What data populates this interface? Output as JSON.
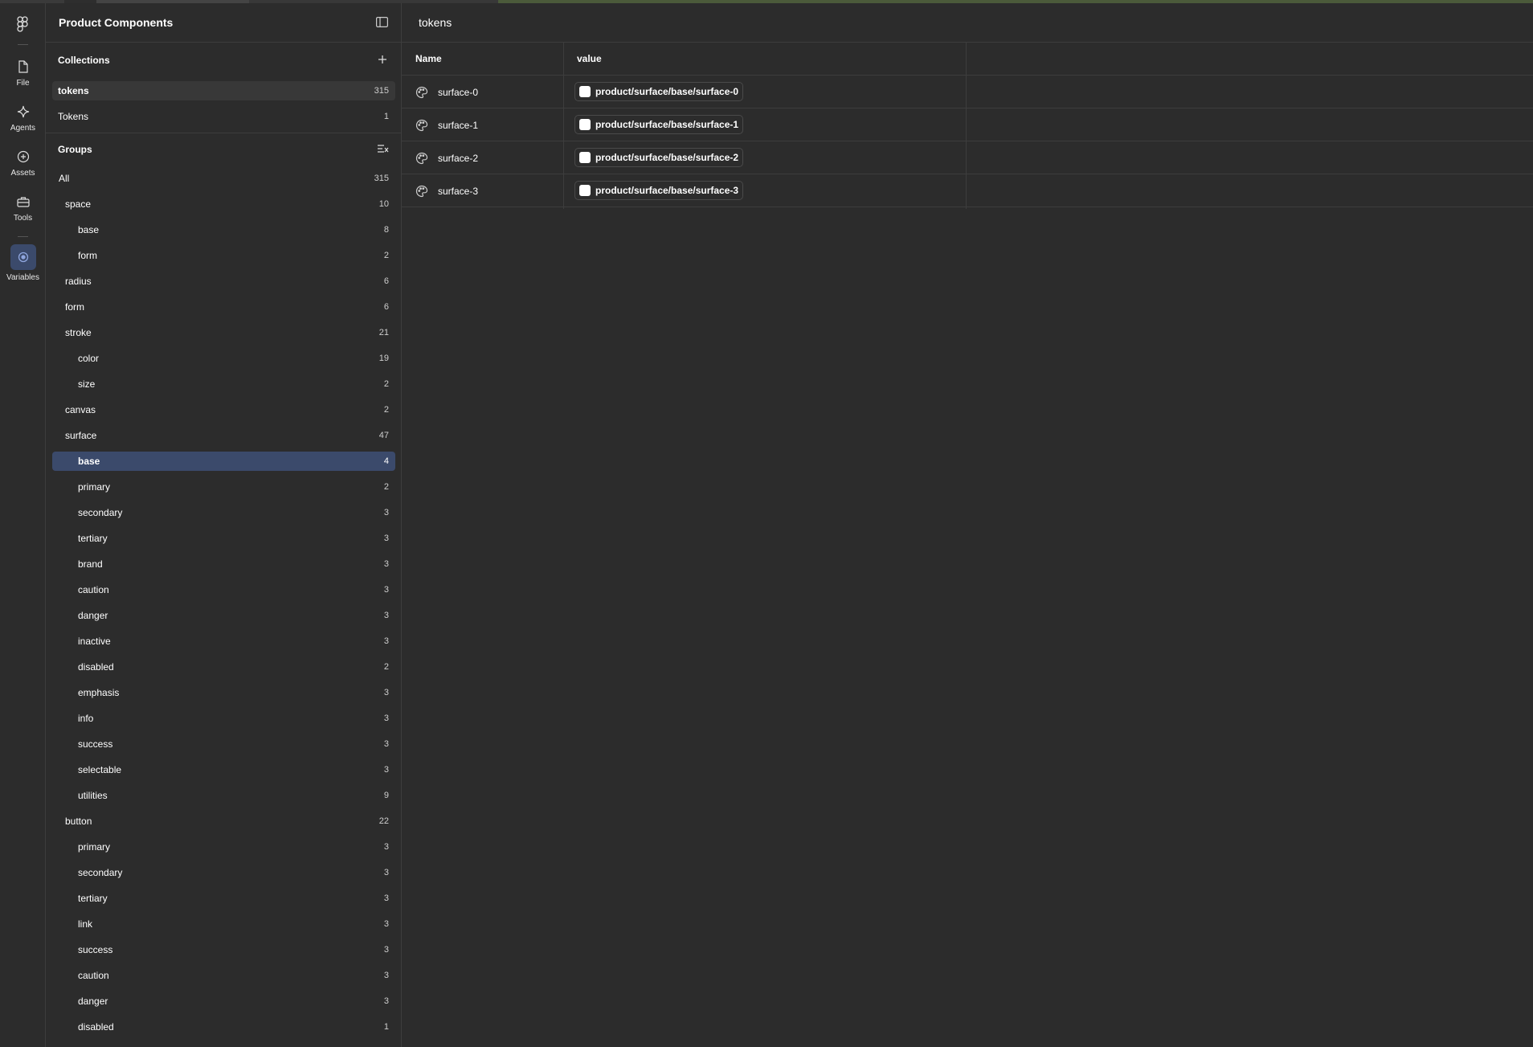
{
  "rail": {
    "items": [
      {
        "label": "File",
        "icon": "file-icon"
      },
      {
        "label": "Agents",
        "icon": "sparkle-icon"
      },
      {
        "label": "Assets",
        "icon": "assets-icon"
      },
      {
        "label": "Tools",
        "icon": "toolbox-icon"
      },
      {
        "label": "Variables",
        "icon": "variables-icon"
      }
    ]
  },
  "sidebar": {
    "title": "Product Components",
    "collections": {
      "title": "Collections",
      "items": [
        {
          "name": "tokens",
          "count": "315"
        },
        {
          "name": "Tokens",
          "count": "1"
        }
      ]
    },
    "groups": {
      "title": "Groups",
      "items": [
        {
          "name": "All",
          "count": "315"
        },
        {
          "name": "space",
          "count": "10"
        },
        {
          "name": "base",
          "count": "8"
        },
        {
          "name": "form",
          "count": "2"
        },
        {
          "name": "radius",
          "count": "6"
        },
        {
          "name": "form",
          "count": "6"
        },
        {
          "name": "stroke",
          "count": "21"
        },
        {
          "name": "color",
          "count": "19"
        },
        {
          "name": "size",
          "count": "2"
        },
        {
          "name": "canvas",
          "count": "2"
        },
        {
          "name": "surface",
          "count": "47"
        },
        {
          "name": "base",
          "count": "4"
        },
        {
          "name": "primary",
          "count": "2"
        },
        {
          "name": "secondary",
          "count": "3"
        },
        {
          "name": "tertiary",
          "count": "3"
        },
        {
          "name": "brand",
          "count": "3"
        },
        {
          "name": "caution",
          "count": "3"
        },
        {
          "name": "danger",
          "count": "3"
        },
        {
          "name": "inactive",
          "count": "3"
        },
        {
          "name": "disabled",
          "count": "2"
        },
        {
          "name": "emphasis",
          "count": "3"
        },
        {
          "name": "info",
          "count": "3"
        },
        {
          "name": "success",
          "count": "3"
        },
        {
          "name": "selectable",
          "count": "3"
        },
        {
          "name": "utilities",
          "count": "9"
        },
        {
          "name": "button",
          "count": "22"
        },
        {
          "name": "primary",
          "count": "3"
        },
        {
          "name": "secondary",
          "count": "3"
        },
        {
          "name": "tertiary",
          "count": "3"
        },
        {
          "name": "link",
          "count": "3"
        },
        {
          "name": "success",
          "count": "3"
        },
        {
          "name": "caution",
          "count": "3"
        },
        {
          "name": "danger",
          "count": "3"
        },
        {
          "name": "disabled",
          "count": "1"
        }
      ]
    }
  },
  "main": {
    "title": "tokens",
    "columns": [
      "Name",
      "value"
    ],
    "rows": [
      {
        "name": "surface-0",
        "value": "product/surface/base/surface-0"
      },
      {
        "name": "surface-1",
        "value": "product/surface/base/surface-1"
      },
      {
        "name": "surface-2",
        "value": "product/surface/base/surface-2"
      },
      {
        "name": "surface-3",
        "value": "product/surface/base/surface-3"
      }
    ]
  },
  "colors": {
    "background": "#2c2c2c",
    "selection": "#3b4a6b",
    "border": "#3d3d3d",
    "swatch": "#ffffff"
  }
}
